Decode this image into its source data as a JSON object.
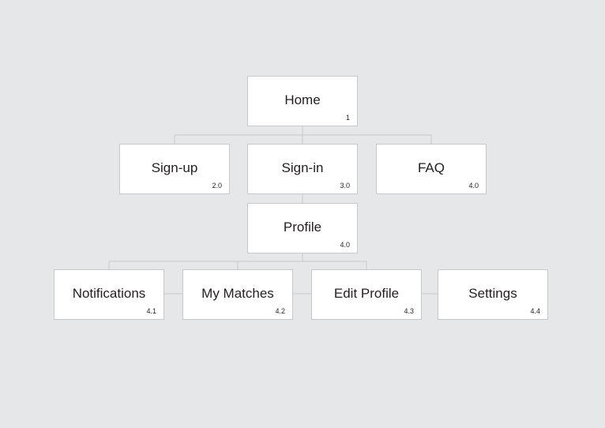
{
  "nodes": [
    {
      "label": "Home",
      "number": "1"
    },
    {
      "label": "Sign-up",
      "number": "2.0"
    },
    {
      "label": "Sign-in",
      "number": "3.0"
    },
    {
      "label": "FAQ",
      "number": "4.0"
    },
    {
      "label": "Profile",
      "number": "4.0"
    },
    {
      "label": "Notifications",
      "number": "4.1"
    },
    {
      "label": "My Matches",
      "number": "4.2"
    },
    {
      "label": "Edit Profile",
      "number": "4.3"
    },
    {
      "label": "Settings",
      "number": "4.4"
    }
  ],
  "edges": [
    {
      "from": "Home",
      "to": "Sign-up"
    },
    {
      "from": "Home",
      "to": "Sign-in"
    },
    {
      "from": "Home",
      "to": "FAQ"
    },
    {
      "from": "Sign-in",
      "to": "Profile"
    },
    {
      "from": "Profile",
      "to": "Notifications"
    },
    {
      "from": "Profile",
      "to": "My Matches"
    },
    {
      "from": "Profile",
      "to": "Edit Profile"
    },
    {
      "from": "Edit Profile",
      "to": "Settings"
    }
  ],
  "colors": {
    "background": "#e6e7e8",
    "box_fill": "#ffffff",
    "box_border": "#c7c8ca",
    "connector": "#c7c8ca",
    "text": "#231f20"
  }
}
